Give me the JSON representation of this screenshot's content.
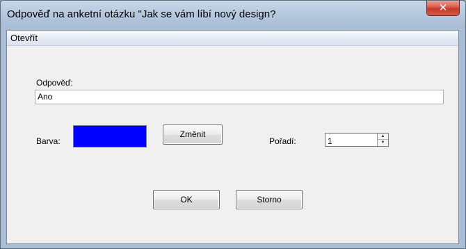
{
  "window": {
    "title": "Odpověď na anketní otázku \"Jak se vám líbí nový design?",
    "close_glyph": "✕"
  },
  "menu": {
    "open_label": "Otevřít"
  },
  "form": {
    "answer_label": "Odpověď:",
    "answer_value": "Ano",
    "color_label": "Barva:",
    "color_value": "#0000ff",
    "change_label": "Změnit",
    "order_label": "Pořadí:",
    "order_value": "1",
    "spin_up_glyph": "▲",
    "spin_down_glyph": "▼"
  },
  "buttons": {
    "ok_label": "OK",
    "cancel_label": "Storno"
  }
}
